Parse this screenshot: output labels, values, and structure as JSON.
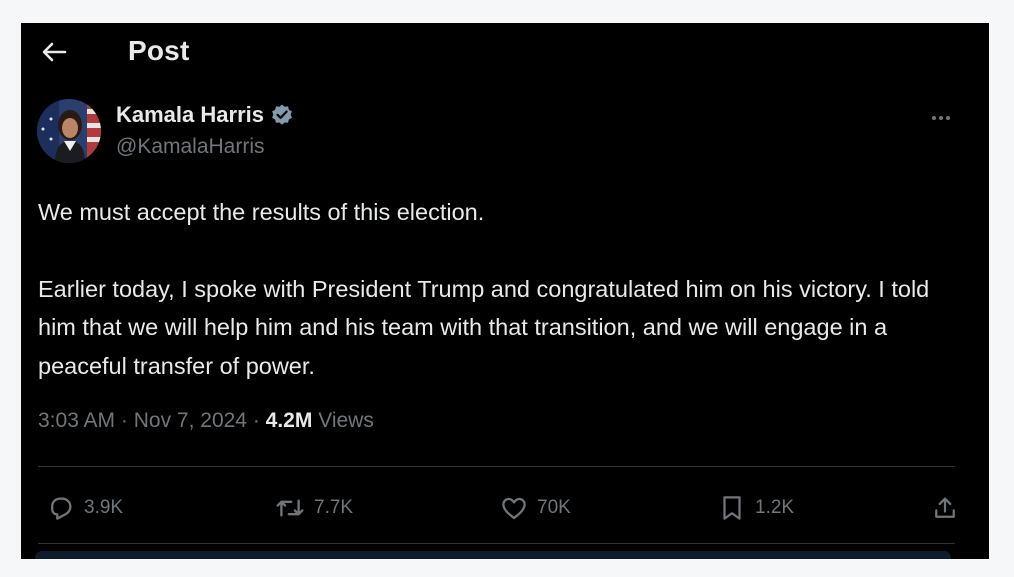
{
  "header": {
    "title": "Post"
  },
  "tweet": {
    "author_name": "Kamala Harris",
    "handle": "@KamalaHarris",
    "paragraphs": [
      "We must accept the results of this election.",
      "Earlier today, I spoke with President Trump and congratulated him on his victory. I told him that we will help him and his team with that transition, and we will engage in a peaceful transfer of power."
    ],
    "time": "3:03 AM",
    "date": "Nov 7, 2024",
    "views_count": "4.2M",
    "views_label": "Views"
  },
  "actions": {
    "replies": "3.9K",
    "reposts": "7.7K",
    "likes": "70K",
    "bookmarks": "1.2K"
  },
  "colors": {
    "background": "#000000",
    "text": "#e7e9ea",
    "secondary_text": "#71767b",
    "verified": "#829aab",
    "divider": "#2f3336"
  },
  "icons": [
    "back-arrow-icon",
    "verified-badge-icon",
    "more-icon",
    "reply-icon",
    "repost-icon",
    "like-icon",
    "bookmark-icon",
    "share-icon"
  ]
}
